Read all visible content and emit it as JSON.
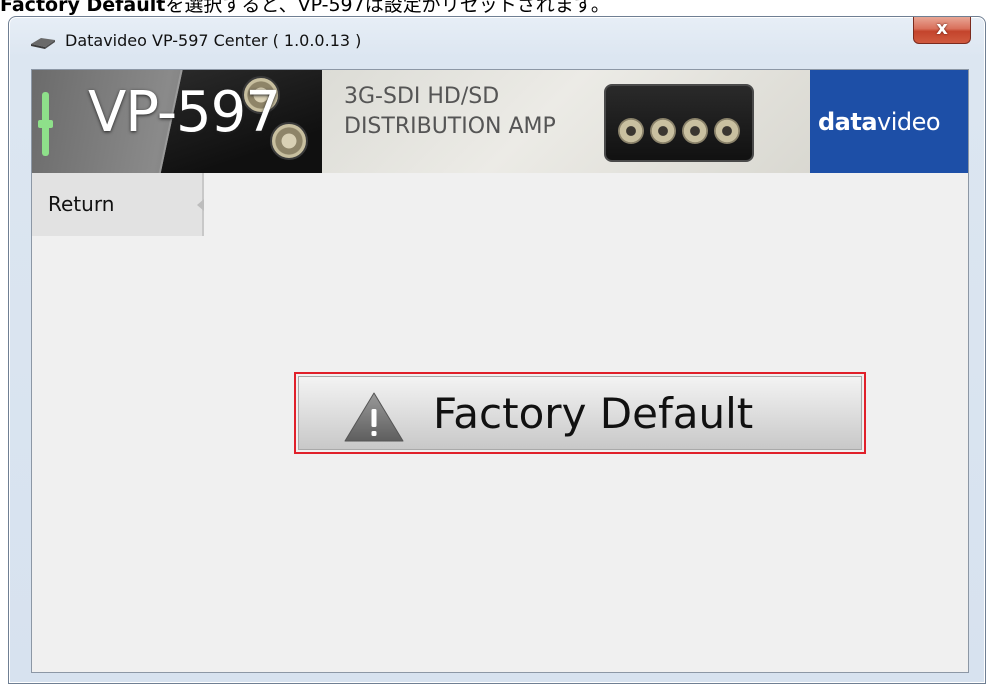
{
  "caption": {
    "bold": "Factory Default",
    "rest": "を選択すると、VP-597は設定がリセットされます。"
  },
  "window": {
    "title": "Datavideo VP-597 Center ( 1.0.0.13 )",
    "close_glyph": "x"
  },
  "banner": {
    "model": "VP-597",
    "subtitle_line1": "3G-SDI HD/SD",
    "subtitle_line2": "DISTRIBUTION AMP",
    "brand_bold": "data",
    "brand_light": "video"
  },
  "sidebar": {
    "items": [
      {
        "label": "Return"
      }
    ]
  },
  "main": {
    "factory_button_label": "Factory Default",
    "factory_icon": "warning-icon"
  },
  "colors": {
    "highlight_border": "#e0202a",
    "brand_blue": "#1d4fa7",
    "close_red": "#c4442c",
    "accent_green": "#8ee08a"
  }
}
